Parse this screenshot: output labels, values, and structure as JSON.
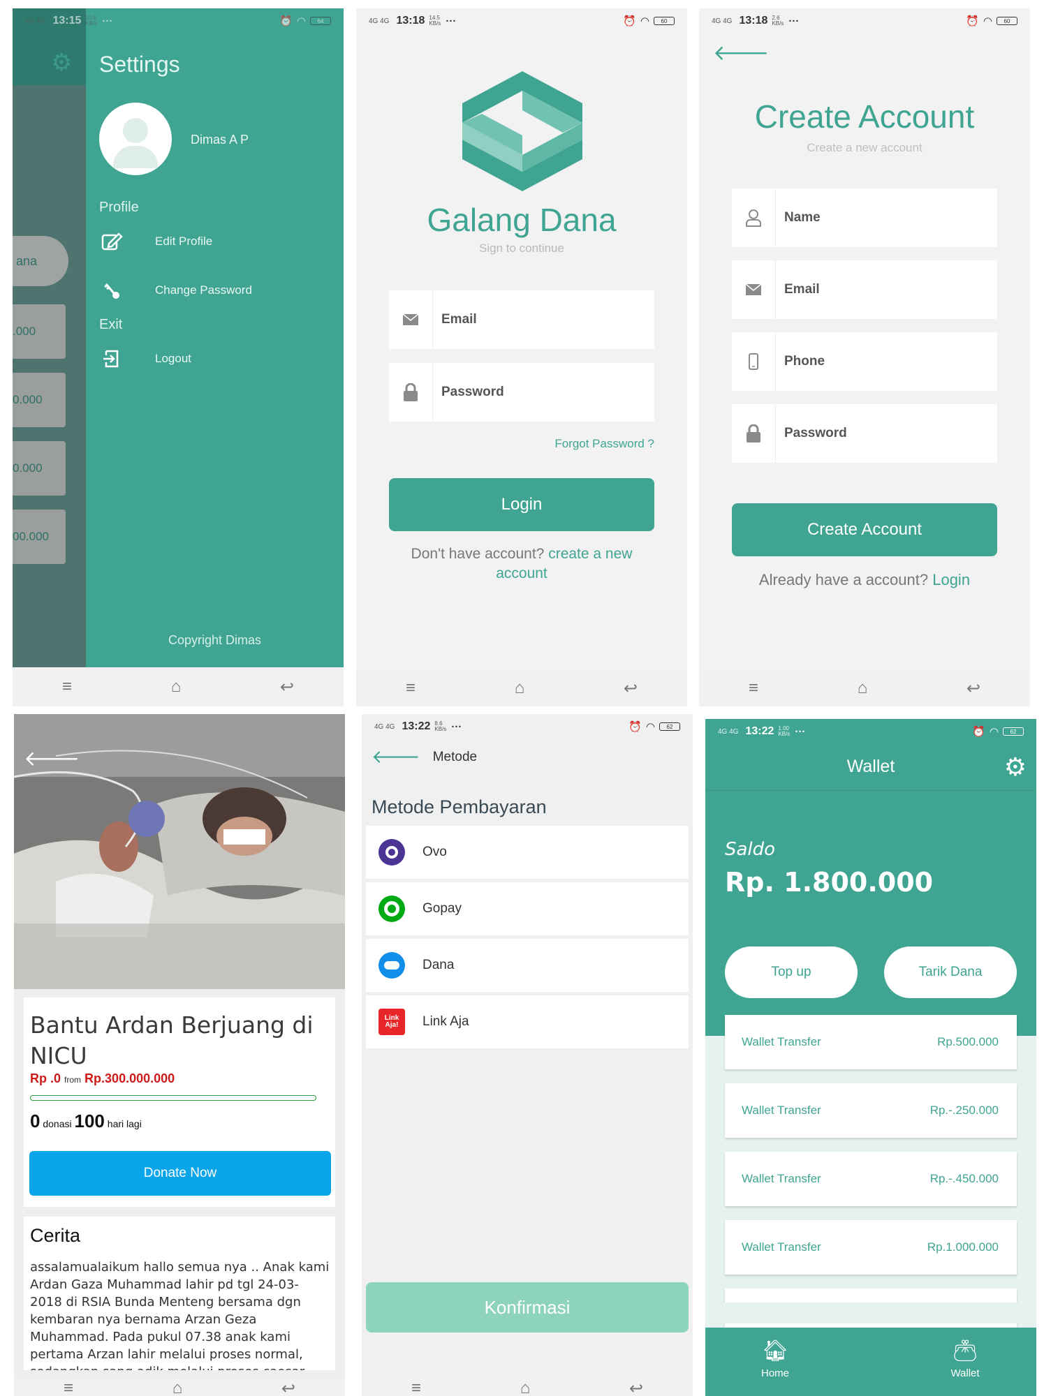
{
  "settings_screen": {
    "status": {
      "signal": "4G 4G",
      "time": "13:15",
      "speed": "10.6 KB/s",
      "battery": "64"
    },
    "title": "Settings",
    "user_name": "Dimas A P",
    "profile_section": "Profile",
    "edit_profile": "Edit Profile",
    "change_password": "Change Password",
    "exit_section": "Exit",
    "logout": "Logout",
    "copyright": "Copyright Dimas",
    "behind": {
      "pill": "ana",
      "amounts": [
        ".000",
        "0.000",
        "0.000",
        "00.000"
      ]
    }
  },
  "login_screen": {
    "status": {
      "signal": "4G 4G",
      "time": "13:18",
      "speed": "14.5 KB/s",
      "battery": "60"
    },
    "app_name": "Galang Dana",
    "subtitle": "Sign to continue",
    "email_placeholder": "Email",
    "password_placeholder": "Password",
    "forgot": "Forgot Password ?",
    "login_button": "Login",
    "no_account": "Don't have account?",
    "create_link": "create a new account"
  },
  "create_screen": {
    "status": {
      "signal": "4G 4G",
      "time": "13:18",
      "speed": "2.6 KB/s",
      "battery": "60"
    },
    "title": "Create Account",
    "subtitle": "Create a new account",
    "name_placeholder": "Name",
    "email_placeholder": "Email",
    "phone_placeholder": "Phone",
    "password_placeholder": "Password",
    "create_button": "Create Account",
    "already": "Already have a account?",
    "login_link": "Login"
  },
  "campaign_screen": {
    "title": "Bantu Ardan Berjuang di NICU",
    "raised": "Rp .0",
    "from": "from",
    "target": "Rp.300.000.000",
    "progress": 0,
    "donations_count": "0",
    "donations_label": "donasi",
    "days_count": "100",
    "days_label": "hari lagi",
    "donate_button": "Donate Now",
    "story_title": "Cerita",
    "story": "assalamualaikum hallo semua nya .. Anak kami Ardan Gaza Muhammad lahir pd tgl 24-03-2018 di RSIA Bunda Menteng bersama dgn kembaran nya bernama Arzan Geza Muhammad. Pada pukul 07.38 anak kami pertama Arzan lahir melalui proses normal, sedangkan sang adik melalui proses caesar lahir sejam berikutnya pd"
  },
  "payment_screen": {
    "status": {
      "signal": "4G 4G",
      "time": "13:22",
      "speed": "8.6 KB/s",
      "battery": "62"
    },
    "header": "Metode",
    "section_title": "Metode Pembayaran",
    "methods": [
      {
        "label": "Ovo",
        "color": "#4c3494"
      },
      {
        "label": "Gopay",
        "color": "#00aa13"
      },
      {
        "label": "Dana",
        "color": "#118eea"
      },
      {
        "label": "Link Aja",
        "color": "#e82529"
      }
    ],
    "linkaja_logo_text": "Link Aja!",
    "confirm_button": "Konfirmasi"
  },
  "wallet_screen": {
    "status": {
      "signal": "4G 4G",
      "time": "13:22",
      "speed": "1.00 KB/s",
      "battery": "62"
    },
    "title": "Wallet",
    "saldo_label": "Saldo",
    "balance": "Rp. 1.800.000",
    "topup_button": "Top up",
    "withdraw_button": "Tarik Dana",
    "transactions": [
      {
        "label": "Wallet Transfer",
        "amount": "Rp.500.000"
      },
      {
        "label": "Wallet Transfer",
        "amount": "Rp.-.250.000"
      },
      {
        "label": "Wallet Transfer",
        "amount": "Rp.-.450.000"
      },
      {
        "label": "Wallet Transfer",
        "amount": "Rp.1.000.000"
      }
    ],
    "nav_home": "Home",
    "nav_wallet": "Wallet"
  },
  "colors": {
    "accent": "#3fa592",
    "donate": "#0aa4ea",
    "alert": "#d01a1a",
    "confirm_disabled": "#8ed3bc"
  }
}
